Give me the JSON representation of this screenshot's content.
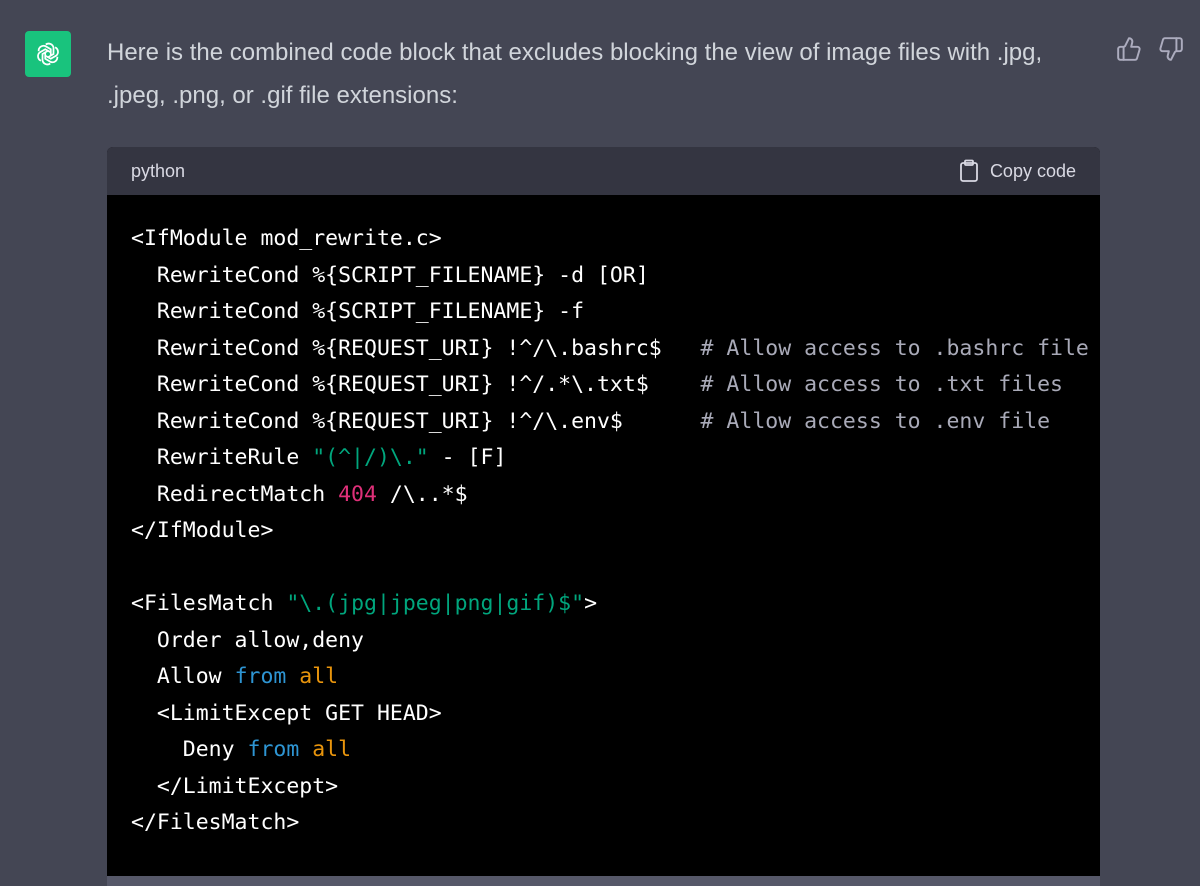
{
  "message": {
    "text": "Here is the combined code block that excludes blocking the view of image files with .jpg, .jpeg, .png, or .gif file extensions:"
  },
  "icons": {
    "avatar": "openai-logo-icon",
    "like": "thumbs-up-icon",
    "dislike": "thumbs-down-icon",
    "copy": "clipboard-icon"
  },
  "code_block": {
    "language": "python",
    "copy_label": "Copy code",
    "lines": [
      [
        [
          "<IfModule mod_rewrite.c>",
          "plain"
        ]
      ],
      [
        [
          "  RewriteCond %{SCRIPT_FILENAME} -d [OR]",
          "plain"
        ]
      ],
      [
        [
          "  RewriteCond %{SCRIPT_FILENAME} -f",
          "plain"
        ]
      ],
      [
        [
          "  RewriteCond %{REQUEST_URI} !^/\\.bashrc$   ",
          "plain"
        ],
        [
          "# Allow access to .bashrc file",
          "cmt"
        ]
      ],
      [
        [
          "  RewriteCond %{REQUEST_URI} !^/.*\\.txt$    ",
          "plain"
        ],
        [
          "# Allow access to .txt files",
          "cmt"
        ]
      ],
      [
        [
          "  RewriteCond %{REQUEST_URI} !^/\\.env$      ",
          "plain"
        ],
        [
          "# Allow access to .env file",
          "cmt"
        ]
      ],
      [
        [
          "  RewriteRule ",
          "plain"
        ],
        [
          "\"(^|/)\\.\"",
          "str"
        ],
        [
          " - [F]",
          "plain"
        ]
      ],
      [
        [
          "  RedirectMatch ",
          "plain"
        ],
        [
          "404",
          "num"
        ],
        [
          " /\\..*$",
          "plain"
        ]
      ],
      [
        [
          "</IfModule>",
          "plain"
        ]
      ],
      [
        [
          "",
          "plain"
        ]
      ],
      [
        [
          "<FilesMatch ",
          "plain"
        ],
        [
          "\"\\.(jpg|jpeg|png|gif)$\"",
          "str"
        ],
        [
          ">",
          "plain"
        ]
      ],
      [
        [
          "  Order allow,deny",
          "plain"
        ]
      ],
      [
        [
          "  Allow ",
          "plain"
        ],
        [
          "from",
          "kw"
        ],
        [
          " ",
          "plain"
        ],
        [
          "all",
          "val"
        ]
      ],
      [
        [
          "  <LimitExcept GET HEAD>",
          "plain"
        ]
      ],
      [
        [
          "    Deny ",
          "plain"
        ],
        [
          "from",
          "kw"
        ],
        [
          " ",
          "plain"
        ],
        [
          "all",
          "val"
        ]
      ],
      [
        [
          "  </LimitExcept>",
          "plain"
        ]
      ],
      [
        [
          "</FilesMatch>",
          "plain"
        ]
      ]
    ]
  },
  "colors": {
    "page_bg": "#444654",
    "avatar_bg": "#19c37d",
    "code_header_bg": "#343541",
    "code_bg": "#000000",
    "string": "#00a67d",
    "number": "#df3079",
    "keyword": "#2e95d3",
    "value": "#e9950c",
    "comment": "#a9aab8"
  }
}
